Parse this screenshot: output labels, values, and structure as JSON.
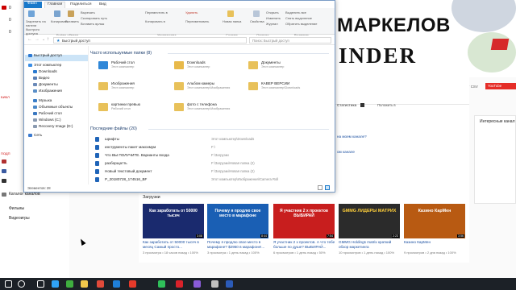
{
  "youtube": {
    "sidebar_top_labels": [
      "0",
      "0",
      "0"
    ],
    "side_section_labels": [
      "БИБЛ",
      "ПОДП"
    ],
    "sidebar_items": [
      "Каталог каналов",
      "Фильмы",
      "Видеоигры"
    ],
    "banner_line1": "МАРКЕЛОВ",
    "banner_line2": "INDER",
    "export_label": "Экспорт CSV",
    "yt_button": "YouTube",
    "stats_tab": "Статистика",
    "bookmark_tab": "Положить в",
    "channel_promo_lines": [
      "на моем канале?",
      "ом канале"
    ],
    "interesting_channels": "Интересные канал",
    "uploads_heading": "Загрузки",
    "videos": [
      {
        "title": "Как заработать от 50000 тысяч в месяц Самый просто...",
        "meta": "3 просмотра • 18 часов назад • 100%",
        "thumb_text": "Как заработать от 50000 тысяч",
        "thumb_bg": "#1a2a6e",
        "duration": "3:08"
      },
      {
        "title": "Почему я продлю свое место в марафоне? $2950 в марафоне!...",
        "meta": "3 просмотра • 1 день назад • 100%",
        "thumb_text": "Почему я продлю свое место в марафоне",
        "thumb_bg": "#1a5fb4",
        "duration": "8:44"
      },
      {
        "title": "Я участник 2 х проектов. А что тебе больше по душе? ВЫБИРАЙ...",
        "meta": "6 просмотров • 1 день назад • 50%",
        "thumb_text": "Я участник 2 х проектов ВЫБИРАЙ",
        "thumb_bg": "#c81e1e",
        "duration": "7:54"
      },
      {
        "title": "GMMG Holdings matrix краткий обзор маркетинга",
        "meta": "10 просмотров • 1 день назад • 100%",
        "thumb_text": "GMMG ЛИДЕРЫ МАТРИХ",
        "thumb_bg": "#2b2b2b",
        "duration": "2:23"
      },
      {
        "title": "Казино КарМен",
        "meta": "9 просмотров • 2 дня назад • 100%",
        "thumb_text": "Казино КарМен",
        "thumb_bg": "#b85a12",
        "duration": "3:56"
      }
    ]
  },
  "explorer": {
    "tabs": [
      "Файл",
      "Главная",
      "Поделиться",
      "Вид"
    ],
    "ribbon": {
      "pin_label": "Закрепить на панели быстрого доступа",
      "copy": "Копировать",
      "paste": "Вставить",
      "cut": "Вырезать",
      "copy_path": "Скопировать путь",
      "paste_shortcut": "Вставить ярлык",
      "move_to": "Переместить в",
      "copy_to": "Копировать в",
      "delete": "Удалить",
      "rename": "Переименовать",
      "new_folder": "Новая папка",
      "properties": "Свойства",
      "open": "Открыть",
      "edit": "Изменить",
      "history": "Журнал",
      "select_all": "Выделить все",
      "select_none": "Снять выделение",
      "invert": "Обратить выделение",
      "group_clipboard": "Буфер обмена",
      "group_organize": "Упорядочить",
      "group_create": "Создать",
      "group_open": "Открыть",
      "group_select": "Выделить"
    },
    "address": {
      "path": "Быстрый доступ",
      "search_placeholder": "Поиск: Быстрый доступ"
    },
    "nav": [
      {
        "label": "Быстрый доступ",
        "icon": "star-icon",
        "color": "#2d7ad4"
      },
      {
        "label": "Этот компьютер",
        "icon": "computer-icon",
        "color": "#3a8ee6"
      },
      {
        "label": "Downloads",
        "icon": "download-icon",
        "color": "#2a7ad0"
      },
      {
        "label": "Видео",
        "icon": "video-icon",
        "color": "#5a7fb4"
      },
      {
        "label": "Документы",
        "icon": "documents-icon",
        "color": "#6a89b8"
      },
      {
        "label": "Изображения",
        "icon": "pictures-icon",
        "color": "#5a8fc8"
      },
      {
        "label": "Музыка",
        "icon": "music-icon",
        "color": "#3a7ec8"
      },
      {
        "label": "Объемные объекты",
        "icon": "3d-icon",
        "color": "#4a88c8"
      },
      {
        "label": "Рабочий стол",
        "icon": "desktop-icon",
        "color": "#3a78c0"
      },
      {
        "label": "Windows (C:)",
        "icon": "drive-icon",
        "color": "#8a9ab0"
      },
      {
        "label": "Recovery Image (D:)",
        "icon": "drive-icon",
        "color": "#8a9ab0"
      },
      {
        "label": "Сеть",
        "icon": "network-icon",
        "color": "#3a7ad0"
      }
    ],
    "frequent_heading": "Часто используемые папки (8)",
    "frequent": [
      {
        "name": "Рабочий стол",
        "sub": "Этот компьютер",
        "icon": "desktop-folder-icon",
        "color": "#2f87d8"
      },
      {
        "name": "Downloads",
        "sub": "Этот компьютер",
        "icon": "downloads-folder-icon",
        "color": "#e8b94a"
      },
      {
        "name": "Документы",
        "sub": "Этот компьютер",
        "icon": "documents-folder-icon",
        "color": "#e8c15a"
      },
      {
        "name": "Изображения",
        "sub": "Этот компьютер",
        "icon": "pictures-folder-icon",
        "color": "#e8c15a"
      },
      {
        "name": "Альбом камеры",
        "sub": "Этот компьютер\\Изображения",
        "icon": "camera-folder-icon",
        "color": "#e8c15a"
      },
      {
        "name": "КАВЕР ВЕРСИИ",
        "sub": "Этот компьютер\\Downloads",
        "icon": "folder-icon",
        "color": "#e8c15a"
      },
      {
        "name": "картинки превью",
        "sub": "Рабочий стол",
        "icon": "folder-icon",
        "color": "#e8c15a"
      },
      {
        "name": "фото с телефона",
        "sub": "Этот компьютер\\Изображения",
        "icon": "folder-icon",
        "color": "#e8c15a"
      }
    ],
    "recent_heading": "Последние файлы (20)",
    "recent": [
      {
        "name": "шрифты",
        "path": "Этот компьютер\\Downloads"
      },
      {
        "name": "инструменты пакет максимум",
        "path": "F:\\"
      },
      {
        "name": "Что ВЫ ПОЛУЧИТЕ. Варианты входа",
        "path": "F:\\Загрузки"
      },
      {
        "name": "разборщатть",
        "path": "F:\\Загрузки\\Новая папка (2)"
      },
      {
        "name": "Новый текстовый документ",
        "path": "F:\\Загрузки\\Новая папка (2)"
      },
      {
        "name": "P_20180728_174516_BF",
        "path": "Этот компьютер\\Изображения\\Camera Roll"
      }
    ],
    "status": "Элементов: 28"
  },
  "taskbar": {
    "icons": [
      {
        "name": "windows-icon",
        "color": "#ffffff"
      },
      {
        "name": "search-icon",
        "color": "#ffffff"
      },
      {
        "name": "task-view-icon",
        "color": "#ffffff"
      },
      {
        "name": "photoshop-icon",
        "color": "#2fa3f7"
      },
      {
        "name": "camtasia-icon",
        "color": "#3fae3f"
      },
      {
        "name": "file-explorer-icon",
        "color": "#f2c94c"
      },
      {
        "name": "chrome-icon",
        "color": "#e04a3a"
      },
      {
        "name": "edge-icon",
        "color": "#1f7fd8"
      },
      {
        "name": "yandex-browser-icon",
        "color": "#e63a2a"
      },
      {
        "name": "whatsapp-icon",
        "color": "#2fbf5a"
      },
      {
        "name": "opera-icon",
        "color": "#d8222a"
      },
      {
        "name": "media-icon",
        "color": "#8a5cd8"
      },
      {
        "name": "app-icon",
        "color": "#c0c0c0"
      },
      {
        "name": "word-icon",
        "color": "#2b5bb8"
      }
    ]
  }
}
